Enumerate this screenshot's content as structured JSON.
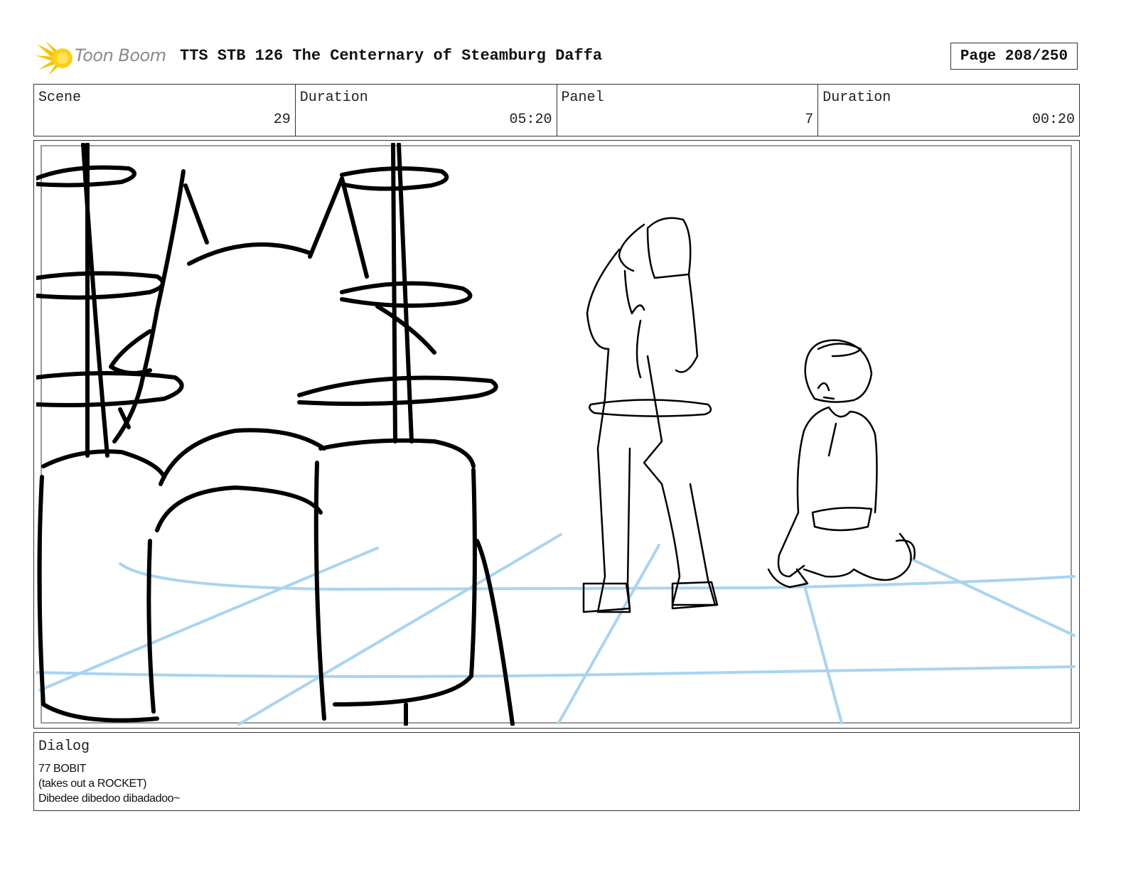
{
  "header": {
    "logo_text": "Toon Boom",
    "title": "TTS STB 126 The Centernary of Steamburg Daffa",
    "page": "Page 208/250"
  },
  "info": [
    {
      "label": "Scene",
      "value": "29"
    },
    {
      "label": "Duration",
      "value": "05:20"
    },
    {
      "label": "Panel",
      "value": "7"
    },
    {
      "label": "Duration",
      "value": "00:20"
    }
  ],
  "dialog": {
    "label": "Dialog",
    "lines": [
      "77 BOBIT",
      "(takes out a ROCKET)",
      "Dibedee dibedoo dibadadoo~"
    ]
  },
  "colors": {
    "guide_lines": "#a9d4f0",
    "ink": "#000000",
    "logo_accent": "#f5c400"
  }
}
